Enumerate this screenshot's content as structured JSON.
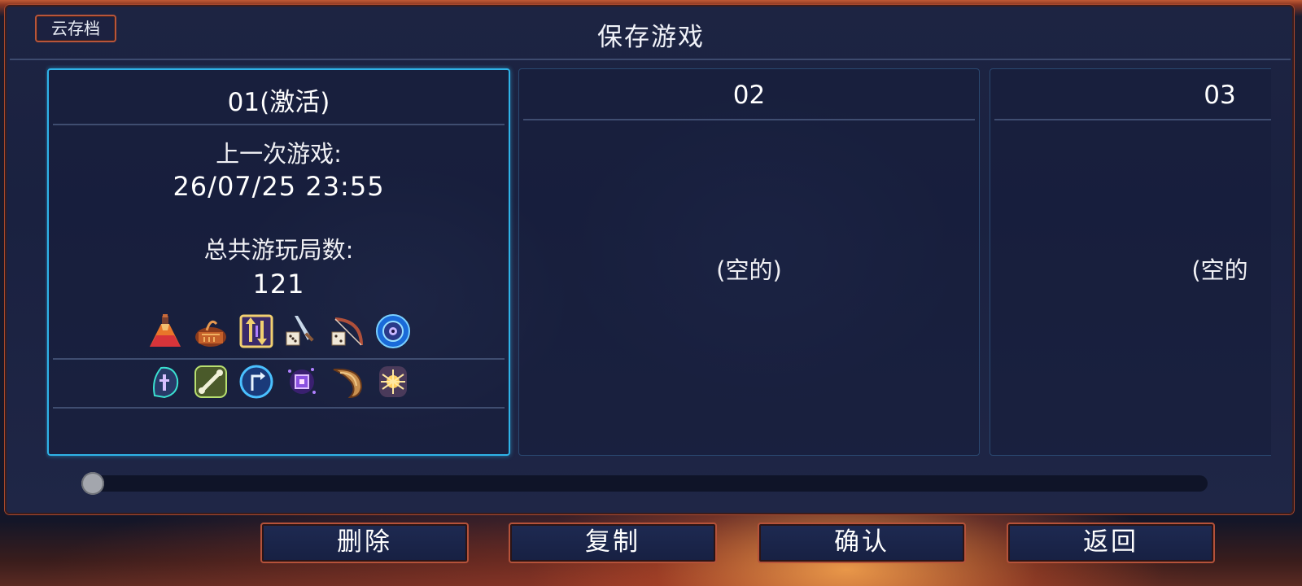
{
  "header": {
    "cloud_save_label": "云存档",
    "title": "保存游戏"
  },
  "slots": [
    {
      "name": "01(激活)",
      "active": true,
      "last_played_label": "上一次游戏:",
      "last_played_value": "26/07/25 23:55",
      "total_runs_label": "总共游玩局数:",
      "total_runs_value": "121",
      "icons_row1": [
        "potion-flask-icon",
        "treasure-chest-icon",
        "swap-arrows-scroll-icon",
        "dice-sword-icon",
        "dice-bow-icon",
        "blue-eye-orb-icon"
      ],
      "icons_row2": [
        "teal-rune-scroll-icon",
        "green-bone-rune-icon",
        "blue-arrow-rune-icon",
        "purple-core-rune-icon",
        "horn-icon",
        "glowing-spider-icon"
      ]
    },
    {
      "name": "02",
      "active": false,
      "empty_label": "(空的)"
    },
    {
      "name": "03",
      "active": false,
      "empty_label": "(空的"
    }
  ],
  "scroll": {
    "position_fraction": 0.0
  },
  "buttons": {
    "delete": "删除",
    "copy": "复制",
    "confirm": "确认",
    "back": "返回"
  },
  "colors": {
    "active_border": "#2fb3e8",
    "frame_accent": "#b5523a",
    "panel_bg": "#1d2442"
  }
}
